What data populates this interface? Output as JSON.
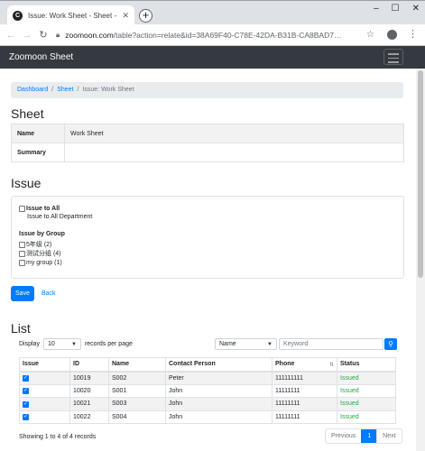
{
  "browser": {
    "tab_title": "Issue: Work Sheet - Sheet - zoomoon",
    "url_host": "zoomoon.com",
    "url_path": "/table?action=relate&id=38A69F40-C78E-42DA-B31B-CA8BAD7…"
  },
  "navbar": {
    "brand": "Zoomoon Sheet"
  },
  "breadcrumb": {
    "items": [
      "Dashboard",
      "Sheet"
    ],
    "current": "Issue: Work Sheet"
  },
  "sheet_section": {
    "heading": "Sheet",
    "rows": [
      {
        "label": "Name",
        "value": "Work Sheet"
      },
      {
        "label": "Summary",
        "value": ""
      }
    ]
  },
  "issue_section": {
    "heading": "Issue",
    "issue_to_all_label": "Issue to All",
    "issue_to_all_desc": "Issue to All Department",
    "by_group_label": "Issue by Group",
    "groups": [
      "5年级 (2)",
      "测试分组 (4)",
      "my group (1)"
    ]
  },
  "actions": {
    "save_label": "Save",
    "back_label": "Back"
  },
  "list_section": {
    "heading": "List",
    "display_label": "Display",
    "page_size": "10",
    "records_per_page_label": "records per page",
    "search_field": "Name",
    "search_placeholder": "Keyword",
    "columns": [
      "Issue",
      "ID",
      "Name",
      "Contact Person",
      "Phone",
      "Status"
    ],
    "rows": [
      {
        "issue": true,
        "id": "10019",
        "name": "S002",
        "contact": "Peter",
        "phone": "111111111",
        "status": "Issued"
      },
      {
        "issue": true,
        "id": "10020",
        "name": "S001",
        "contact": "John",
        "phone": "11111111",
        "status": "Issued"
      },
      {
        "issue": true,
        "id": "10021",
        "name": "S003",
        "contact": "John",
        "phone": "11111111",
        "status": "Issued"
      },
      {
        "issue": true,
        "id": "10022",
        "name": "S004",
        "contact": "John",
        "phone": "11111111",
        "status": "Issued"
      }
    ],
    "summary": "Showing 1 to 4 of 4 records",
    "pager": {
      "previous": "Previous",
      "current": "1",
      "next": "Next"
    }
  },
  "colors": {
    "primary": "#007bff",
    "navbar": "#343a40",
    "success": "#28a745"
  }
}
